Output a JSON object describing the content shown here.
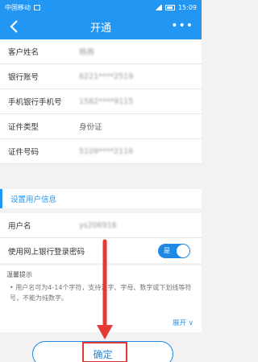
{
  "status_bar": {
    "carrier": "中国移动",
    "time": "15:09"
  },
  "header": {
    "title": "开通",
    "more_label": "•••"
  },
  "fields": [
    {
      "label": "客户姓名",
      "value": "杨燕"
    },
    {
      "label": "银行账号",
      "value": "6221****2519"
    },
    {
      "label": "手机银行手机号",
      "value": "1582****9115"
    },
    {
      "label": "证件类型",
      "value": "身份证"
    },
    {
      "label": "证件号码",
      "value": "5109****2116"
    }
  ],
  "section": {
    "title": "设置用户信息"
  },
  "user": {
    "username_label": "用户名",
    "username_value": "ys206916",
    "use_password_label": "使用网上银行登录密码",
    "toggle_label": "是"
  },
  "tips": {
    "title": "温馨提示",
    "body": "• 用户名可为4-14个字符，支持汉字、字母、数字或下划线等符号，不能为纯数字。",
    "expand_label": "展开"
  },
  "confirm_label": "确定",
  "colors": {
    "primary": "#2196f3",
    "annotation": "#e53935"
  }
}
